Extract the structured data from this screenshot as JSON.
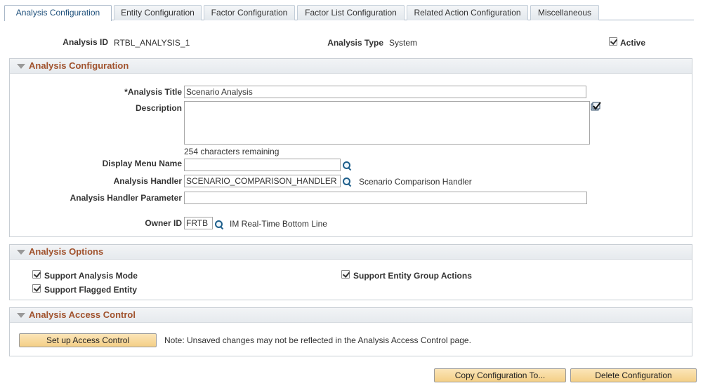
{
  "tabs": [
    {
      "label": "Analysis Configuration",
      "active": true
    },
    {
      "label": "Entity Configuration",
      "active": false
    },
    {
      "label": "Factor Configuration",
      "active": false
    },
    {
      "label": "Factor List Configuration",
      "active": false
    },
    {
      "label": "Related Action Configuration",
      "active": false
    },
    {
      "label": "Miscellaneous",
      "active": false
    }
  ],
  "header": {
    "analysis_id_label": "Analysis ID",
    "analysis_id_value": "RTBL_ANALYSIS_1",
    "analysis_type_label": "Analysis Type",
    "analysis_type_value": "System",
    "active_label": "Active",
    "active_checked": true
  },
  "analysis_config": {
    "title": "Analysis Configuration",
    "analysis_title_label": "*Analysis Title",
    "analysis_title_value": "Scenario Analysis",
    "description_label": "Description",
    "description_value": "",
    "chars_remaining": "254 characters remaining",
    "display_menu_label": "Display Menu Name",
    "display_menu_value": "",
    "handler_label": "Analysis Handler",
    "handler_value": "SCENARIO_COMPARISON_HANDLER",
    "handler_desc": "Scenario Comparison Handler",
    "handler_param_label": "Analysis Handler Parameter",
    "handler_param_value": "",
    "owner_label": "Owner ID",
    "owner_value": "FRTB",
    "owner_desc": "IM Real-Time Bottom Line"
  },
  "analysis_options": {
    "title": "Analysis Options",
    "support_mode_label": "Support Analysis Mode",
    "support_flagged_label": "Support Flagged Entity",
    "support_group_label": "Support Entity Group Actions"
  },
  "access_control": {
    "title": "Analysis Access Control",
    "setup_button": "Set up Access Control",
    "note": "Note: Unsaved changes may not be reflected in the Analysis Access Control page."
  },
  "footer": {
    "copy_button": "Copy Configuration To...",
    "delete_button": "Delete Configuration"
  },
  "colors": {
    "group_title": "#a0522d",
    "active_tab_text": "#1d4f7a",
    "button_fill": "#f4cf86"
  }
}
